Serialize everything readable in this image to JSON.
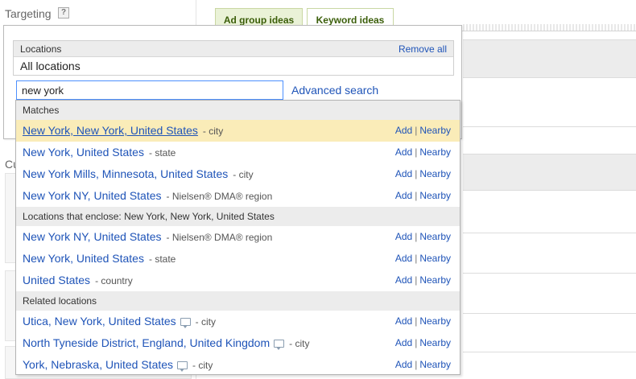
{
  "targeting": {
    "title": "Targeting",
    "help": "?",
    "cu": "Cu"
  },
  "tabs": [
    {
      "label": "Ad group ideas"
    },
    {
      "label": "Keyword ideas"
    }
  ],
  "locations": {
    "header": "Locations",
    "remove_all": "Remove all",
    "selected": "All locations"
  },
  "search": {
    "value": "new york",
    "advanced": "Advanced search"
  },
  "actions": {
    "add": "Add",
    "sep": "|",
    "nearby": "Nearby"
  },
  "dropdown": {
    "matches_header": "Matches",
    "matches": [
      {
        "name": "New York, New York, United States",
        "type": "- city"
      },
      {
        "name": "New York, United States",
        "type": "- state"
      },
      {
        "name": "New York Mills, Minnesota, United States",
        "type": "- city"
      },
      {
        "name": "New York NY, United States",
        "type": "- Nielsen® DMA® region"
      }
    ],
    "enclose_header": "Locations that enclose: New York, New York, United States",
    "enclose": [
      {
        "name": "New York NY, United States",
        "type": "- Nielsen® DMA® region"
      },
      {
        "name": "New York, United States",
        "type": "- state"
      },
      {
        "name": "United States",
        "type": "- country"
      }
    ],
    "related_header": "Related locations",
    "related": [
      {
        "name": "Utica, New York, United States",
        "type": "- city"
      },
      {
        "name": "North Tyneside District, England, United Kingdom",
        "type": "- city"
      },
      {
        "name": "York, Nebraska, United States",
        "type": "- city"
      }
    ]
  }
}
